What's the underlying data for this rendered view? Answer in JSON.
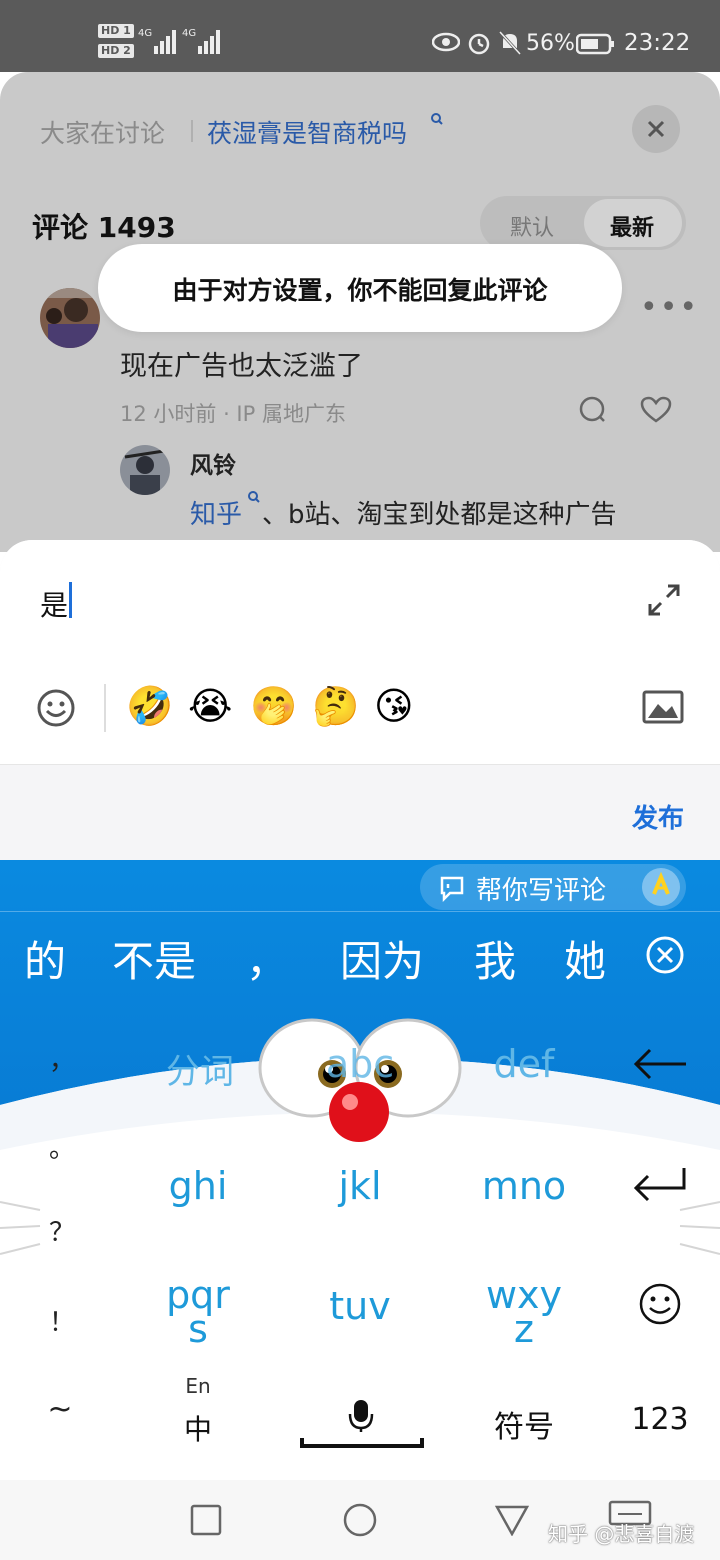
{
  "status_bar": {
    "hd1": "HD 1",
    "hd2": "HD 2",
    "net1": "4G",
    "net2": "4G",
    "battery": "56%",
    "time": "23:22"
  },
  "header": {
    "discussing_label": "大家在讨论",
    "topic": "茯湿膏是智商税吗",
    "close_icon": "close-icon"
  },
  "comments": {
    "title": "评论 1493",
    "sort_default": "默认",
    "sort_latest": "最新",
    "toast": "由于对方设置，你不能回复此评论",
    "main_comment": {
      "text": "现在广告也太泛滥了",
      "meta": "12 小时前 · IP 属地广东"
    },
    "reply": {
      "author": "风铃",
      "link": "知乎",
      "text": "、b站、淘宝到处都是这种广告"
    }
  },
  "composer": {
    "text": "是",
    "publish": "发布",
    "emojis": [
      "🤣",
      "😭",
      "🤭",
      "🤔",
      "😘"
    ]
  },
  "keyboard": {
    "assist_label": "帮你写评论",
    "candidates": [
      "的",
      "不是",
      "，",
      "因为",
      "我",
      "她"
    ],
    "side_keys": [
      "，",
      "。",
      "？",
      "！",
      "~"
    ],
    "keys": {
      "k1": "分词",
      "k2": "abc",
      "k3": "def",
      "k4": "ghi",
      "k5": "jkl",
      "k6": "mno",
      "k7": "pqr",
      "k7b": "s",
      "k8": "tuv",
      "k9": "wxy",
      "k9b": "z",
      "lang_top": "En",
      "lang_main": "中",
      "symbols": "符号",
      "numbers": "123"
    }
  },
  "watermark": "知乎 @悲喜自渡",
  "colors": {
    "accent": "#1e6fd9",
    "keyboard_blue": "#0a7fdc",
    "key_text": "#1e9ad9"
  }
}
